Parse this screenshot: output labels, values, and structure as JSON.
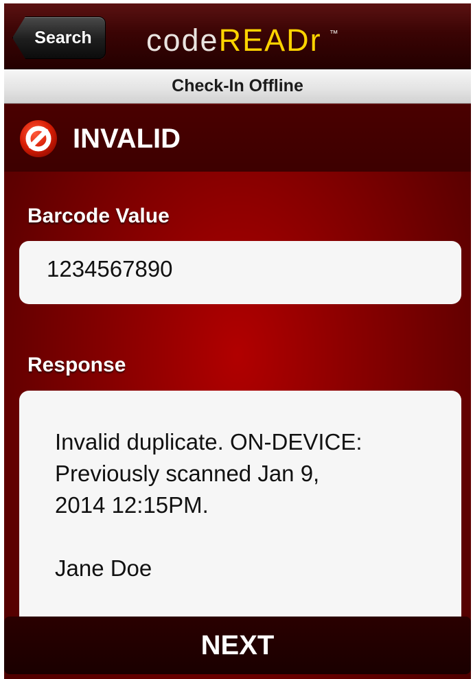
{
  "navbar": {
    "back_label": "Search",
    "logo_code": "code",
    "logo_read": "READr",
    "logo_tm": "™"
  },
  "section": {
    "title": "Check-In Offline"
  },
  "status": {
    "icon": "no-entry-icon",
    "text": "INVALID"
  },
  "barcode": {
    "label": "Barcode Value",
    "value": "1234567890"
  },
  "response": {
    "label": "Response",
    "lines": [
      "Invalid duplicate. ON-DEVICE:",
      "Previously scanned Jan 9,",
      "2014 12:15PM."
    ],
    "name": "Jane Doe"
  },
  "footer": {
    "next_label": "NEXT"
  },
  "colors": {
    "brand_yellow": "#ffd400",
    "background_red": "#8a0000",
    "status_icon_red": "#d81e05"
  }
}
